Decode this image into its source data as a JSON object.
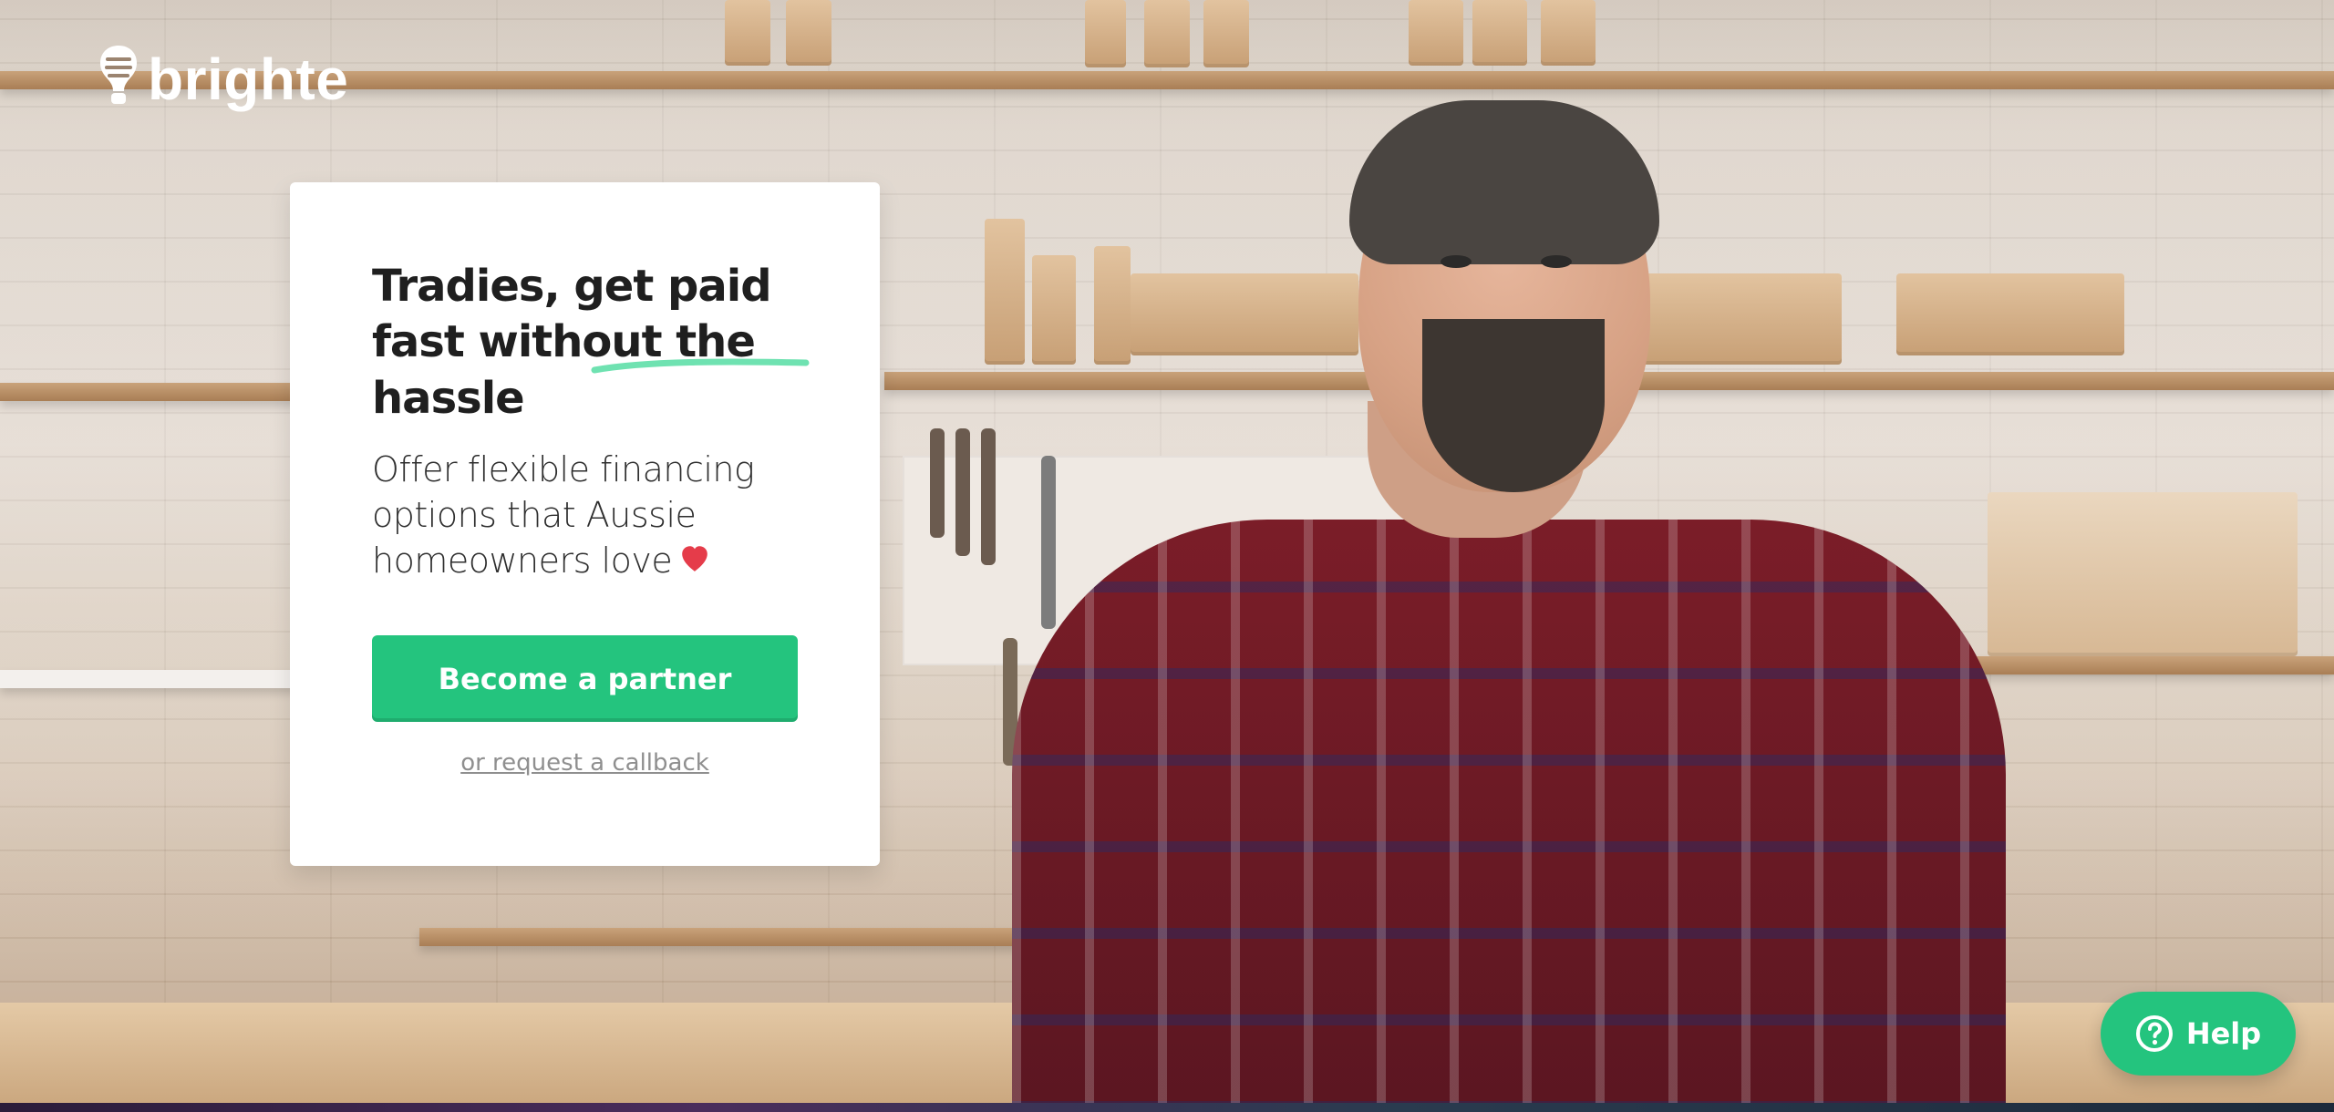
{
  "logo": {
    "text": "brighte",
    "icon": "lightbulb-icon"
  },
  "hero": {
    "headline": "Tradies, get paid fast without the hassle",
    "subtext": "Offer flexible financing options that Aussie homeowners love",
    "heart_icon": "heart-icon",
    "cta_label": "Become a partner",
    "secondary_link": "or request a callback"
  },
  "help": {
    "label": "Help",
    "icon": "question-circle-icon"
  },
  "colors": {
    "brand_green": "#24c47e",
    "heart_red": "#e53c4a",
    "underline_green": "#6fe2b1"
  }
}
